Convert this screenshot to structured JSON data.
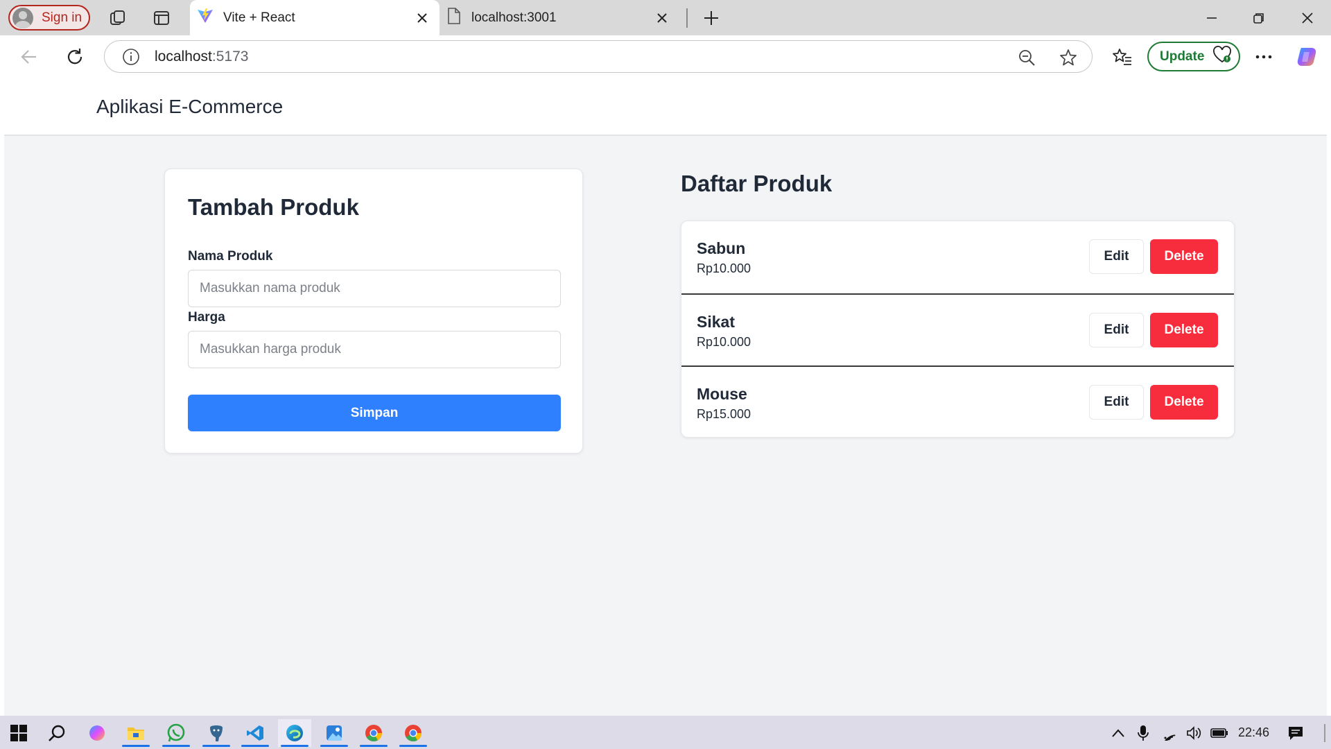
{
  "browser": {
    "signin_label": "Sign in",
    "tabs": [
      {
        "title": "Vite + React",
        "icon": "vite-icon",
        "active": true
      },
      {
        "title": "localhost:3001",
        "icon": "document-icon",
        "active": false
      }
    ],
    "address": {
      "host": "localhost",
      "port": ":5173"
    },
    "update_label": "Update"
  },
  "app": {
    "title": "Aplikasi E-Commerce",
    "form": {
      "heading": "Tambah Produk",
      "name_label": "Nama Produk",
      "name_placeholder": "Masukkan nama produk",
      "price_label": "Harga",
      "price_placeholder": "Masukkan harga produk",
      "save_label": "Simpan"
    },
    "list": {
      "heading": "Daftar Produk",
      "edit_label": "Edit",
      "delete_label": "Delete",
      "products": [
        {
          "name": "Sabun",
          "price": "Rp10.000"
        },
        {
          "name": "Sikat",
          "price": "Rp10.000"
        },
        {
          "name": "Mouse",
          "price": "Rp15.000"
        }
      ]
    }
  },
  "taskbar": {
    "time": "22:46",
    "apps": [
      "windows-start-icon",
      "search-icon",
      "copilot-icon",
      "file-explorer-icon",
      "whatsapp-icon",
      "postgres-icon",
      "vscode-icon",
      "edge-icon",
      "photos-icon",
      "chrome-icon",
      "chrome-icon"
    ]
  },
  "colors": {
    "primary": "#2f80ff",
    "danger": "#f72d3d",
    "page_bg": "#f3f4f6",
    "update_green": "#1e7a34"
  }
}
